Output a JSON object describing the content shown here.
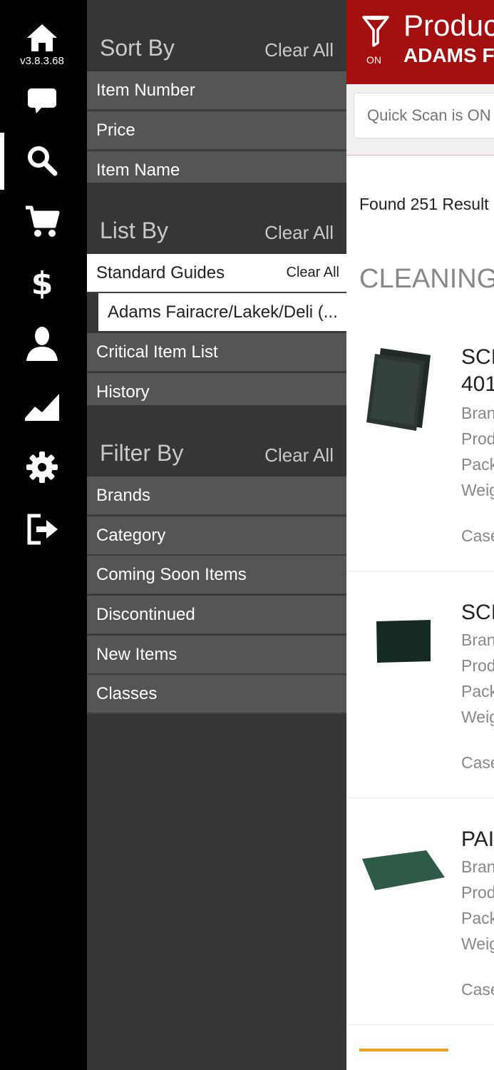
{
  "rail": {
    "version": "v3.8.3.68",
    "items": [
      {
        "icon": "home-icon"
      },
      {
        "icon": "chat-icon"
      },
      {
        "icon": "search-icon"
      },
      {
        "icon": "cart-icon"
      },
      {
        "icon": "dollar-icon"
      },
      {
        "icon": "user-icon"
      },
      {
        "icon": "chart-icon"
      },
      {
        "icon": "gear-icon"
      },
      {
        "icon": "logout-icon"
      }
    ]
  },
  "drawer": {
    "sort": {
      "title": "Sort By",
      "clear": "Clear All",
      "options": [
        "Item Number",
        "Price",
        "Item Name"
      ]
    },
    "list": {
      "title": "List By",
      "clear": "Clear All",
      "selected": {
        "label": "Standard Guides",
        "clear": "Clear All"
      },
      "sub_option": "Adams Fairacre/Lakek/Deli (...",
      "options": [
        "Critical Item List",
        "History"
      ]
    },
    "filter": {
      "title": "Filter By",
      "clear": "Clear All",
      "options": [
        "Brands",
        "Category",
        "Coming Soon Items",
        "Discontinued",
        "New Items",
        "Classes"
      ]
    }
  },
  "main": {
    "header": {
      "filter_status": "ON",
      "title": "Produc",
      "subtitle": "ADAMS F"
    },
    "search": {
      "placeholder": "Quick Scan is ON"
    },
    "found": "Found 251 Result",
    "category": "CLEANING",
    "products": [
      {
        "title_lines": [
          "SCI",
          "401"
        ],
        "lines": [
          "Bran",
          "Prod",
          "Pack",
          "Weig"
        ],
        "case": "Case"
      },
      {
        "title_lines": [
          "SCI"
        ],
        "lines": [
          "Bran",
          "Prod",
          "Pack",
          "Weig"
        ],
        "case": "Case"
      },
      {
        "title_lines": [
          "PAI"
        ],
        "lines": [
          "Bran",
          "Prod",
          "Pack",
          "Weig"
        ],
        "case": "Case"
      }
    ],
    "colors": {
      "header_bg": "#a30f0f",
      "accent_underline": "#e8a21e"
    }
  }
}
